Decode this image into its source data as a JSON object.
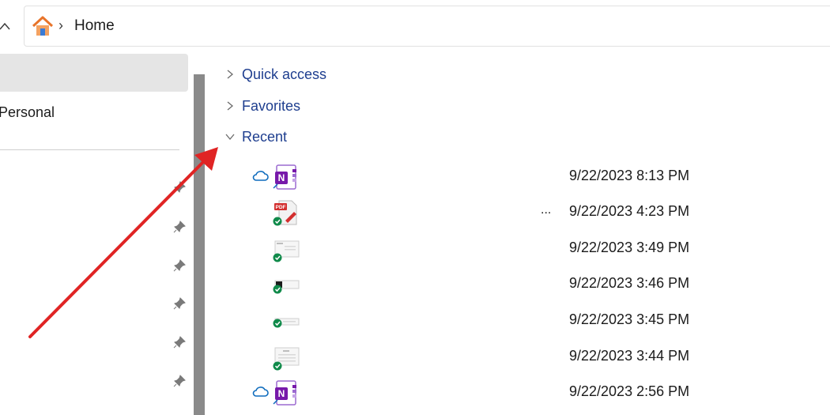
{
  "address_bar": {
    "breadcrumb": [
      "Home"
    ]
  },
  "navigation": {
    "items": [
      {
        "label": ""
      },
      {
        "label": "Personal"
      }
    ],
    "pinned_items_count": 6
  },
  "content": {
    "sections": [
      {
        "label": "Quick access",
        "expanded": false
      },
      {
        "label": "Favorites",
        "expanded": false
      },
      {
        "label": "Recent",
        "expanded": true
      }
    ],
    "recent_files": [
      {
        "type": "onenote",
        "status": "cloud",
        "date": "9/22/2023 8:13 PM",
        "more": ""
      },
      {
        "type": "pdf",
        "status": "synced",
        "date": "9/22/2023 4:23 PM",
        "more": "..."
      },
      {
        "type": "image",
        "status": "synced",
        "date": "9/22/2023 3:49 PM",
        "more": ""
      },
      {
        "type": "image",
        "status": "synced",
        "date": "9/22/2023 3:46 PM",
        "more": ""
      },
      {
        "type": "image",
        "status": "synced",
        "date": "9/22/2023 3:45 PM",
        "more": ""
      },
      {
        "type": "image",
        "status": "synced",
        "date": "9/22/2023 3:44 PM",
        "more": ""
      },
      {
        "type": "onenote",
        "status": "cloud",
        "date": "9/22/2023 2:56 PM",
        "more": ""
      }
    ]
  },
  "colors": {
    "section_link": "#1e3e8f",
    "annotation_arrow": "#e02424",
    "synced_badge": "#108a4a",
    "onenote_purple": "#7719aa",
    "pdf_red": "#d32f2f",
    "cloud_blue": "#0f6cbd"
  },
  "icons": {
    "up": "chevron-up-icon",
    "home": "home-icon",
    "breadcrumb_separator": "chevron-right-icon",
    "pin": "pin-icon",
    "collapsed": "chevron-right-icon",
    "expanded": "chevron-down-icon",
    "cloud": "cloud-icon",
    "synced": "check-badge-icon"
  }
}
